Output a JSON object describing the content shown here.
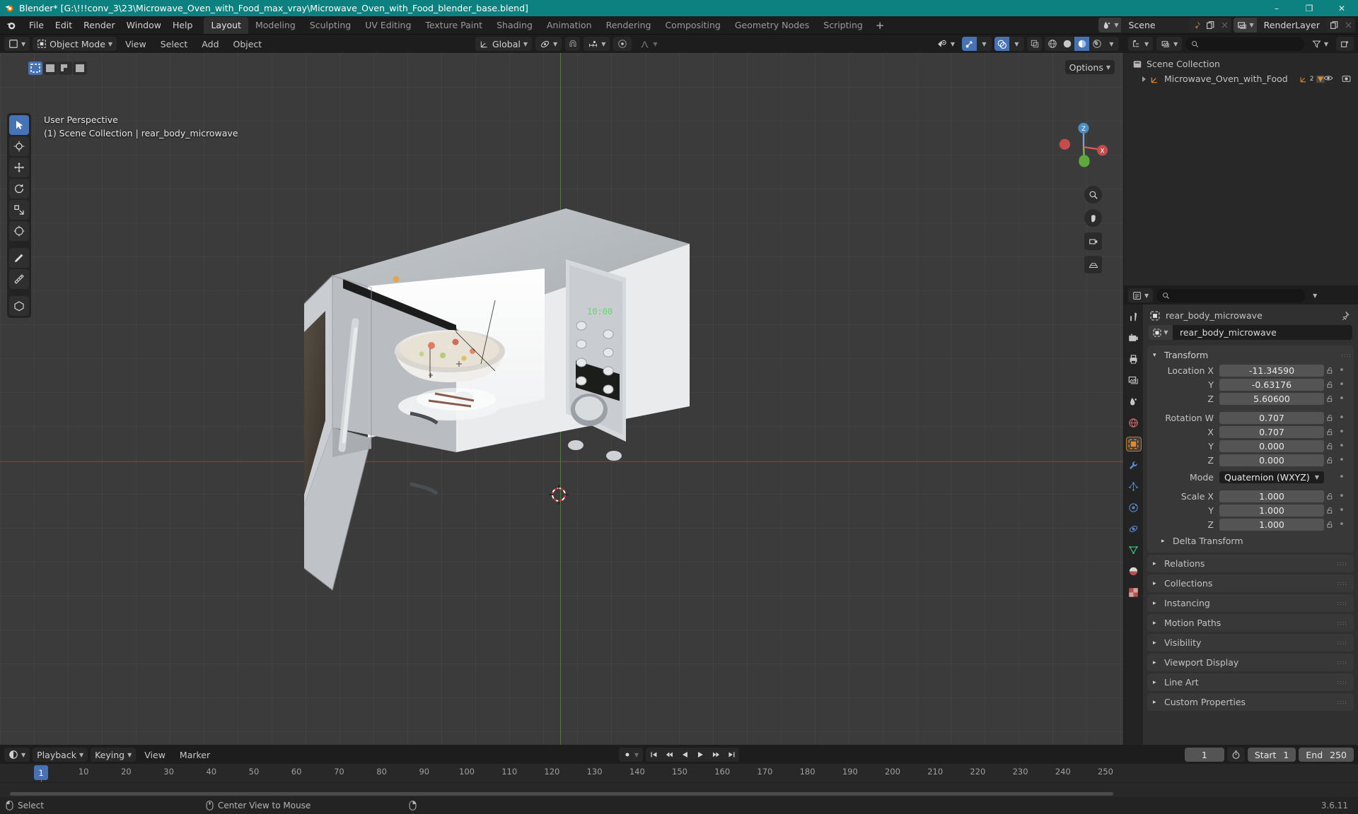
{
  "titlebar": {
    "title": "Blender* [G:\\!!!conv_3\\23\\Microwave_Oven_with_Food_max_vray\\Microwave_Oven_with_Food_blender_base.blend]",
    "minimize": "–",
    "maximize": "❐",
    "close": "✕"
  },
  "topbar": {
    "menus": [
      "File",
      "Edit",
      "Render",
      "Window",
      "Help"
    ],
    "tabs": [
      {
        "label": "Layout",
        "active": true
      },
      {
        "label": "Modeling",
        "active": false
      },
      {
        "label": "Sculpting",
        "active": false
      },
      {
        "label": "UV Editing",
        "active": false
      },
      {
        "label": "Texture Paint",
        "active": false
      },
      {
        "label": "Shading",
        "active": false
      },
      {
        "label": "Animation",
        "active": false
      },
      {
        "label": "Rendering",
        "active": false
      },
      {
        "label": "Compositing",
        "active": false
      },
      {
        "label": "Geometry Nodes",
        "active": false
      },
      {
        "label": "Scripting",
        "active": false
      }
    ],
    "add_tab": "+",
    "scene_name": "Scene",
    "view_layer_name": "RenderLayer"
  },
  "viewport": {
    "mode": "Object Mode",
    "menus": [
      "View",
      "Select",
      "Add",
      "Object"
    ],
    "transform_orientation": "Global",
    "options_label": "Options",
    "overlay_line1": "User Perspective",
    "overlay_line2": "(1) Scene Collection | rear_body_microwave"
  },
  "outliner": {
    "search_placeholder": "",
    "rows": [
      {
        "label": "Scene Collection",
        "indent": 0
      },
      {
        "label": "Microwave_Oven_with_Food",
        "indent": 1,
        "badge": "2"
      }
    ]
  },
  "properties": {
    "breadcrumb_object": "rear_body_microwave",
    "object_name_field": "rear_body_microwave",
    "transform_title": "Transform",
    "fields": [
      {
        "label": "Location X",
        "value": "-11.34590"
      },
      {
        "label": "Y",
        "value": "-0.63176"
      },
      {
        "label": "Z",
        "value": "5.60600"
      }
    ],
    "rotation": [
      {
        "label": "Rotation W",
        "value": "0.707"
      },
      {
        "label": "X",
        "value": "0.707"
      },
      {
        "label": "Y",
        "value": "0.000"
      },
      {
        "label": "Z",
        "value": "0.000"
      }
    ],
    "mode_label": "Mode",
    "mode_value": "Quaternion (WXYZ)",
    "scale": [
      {
        "label": "Scale X",
        "value": "1.000"
      },
      {
        "label": "Y",
        "value": "1.000"
      },
      {
        "label": "Z",
        "value": "1.000"
      }
    ],
    "delta_transform": "Delta Transform",
    "collapsed_panels": [
      "Relations",
      "Collections",
      "Instancing",
      "Motion Paths",
      "Visibility",
      "Viewport Display",
      "Line Art",
      "Custom Properties"
    ]
  },
  "timeline": {
    "menus": [
      "Playback",
      "Keying",
      "View",
      "Marker"
    ],
    "current_frame": "1",
    "start_label": "Start",
    "start_value": "1",
    "end_label": "End",
    "end_value": "250",
    "ticks": [
      "1",
      "10",
      "20",
      "30",
      "40",
      "50",
      "60",
      "70",
      "80",
      "90",
      "100",
      "110",
      "120",
      "130",
      "140",
      "150",
      "160",
      "170",
      "180",
      "190",
      "200",
      "210",
      "220",
      "230",
      "240",
      "250"
    ],
    "playhead_frame": "1"
  },
  "statusbar": {
    "items": [
      {
        "label": "Select"
      },
      {
        "label": "Center View to Mouse"
      },
      {
        "label": ""
      }
    ],
    "version": "3.6.11"
  },
  "colors": {
    "title_bar": "#0d8080",
    "accent_blue": "#4772b3",
    "orange": "#e08a2b",
    "panel_bg": "#303030",
    "viewport_bg": "#3b3b3b"
  }
}
